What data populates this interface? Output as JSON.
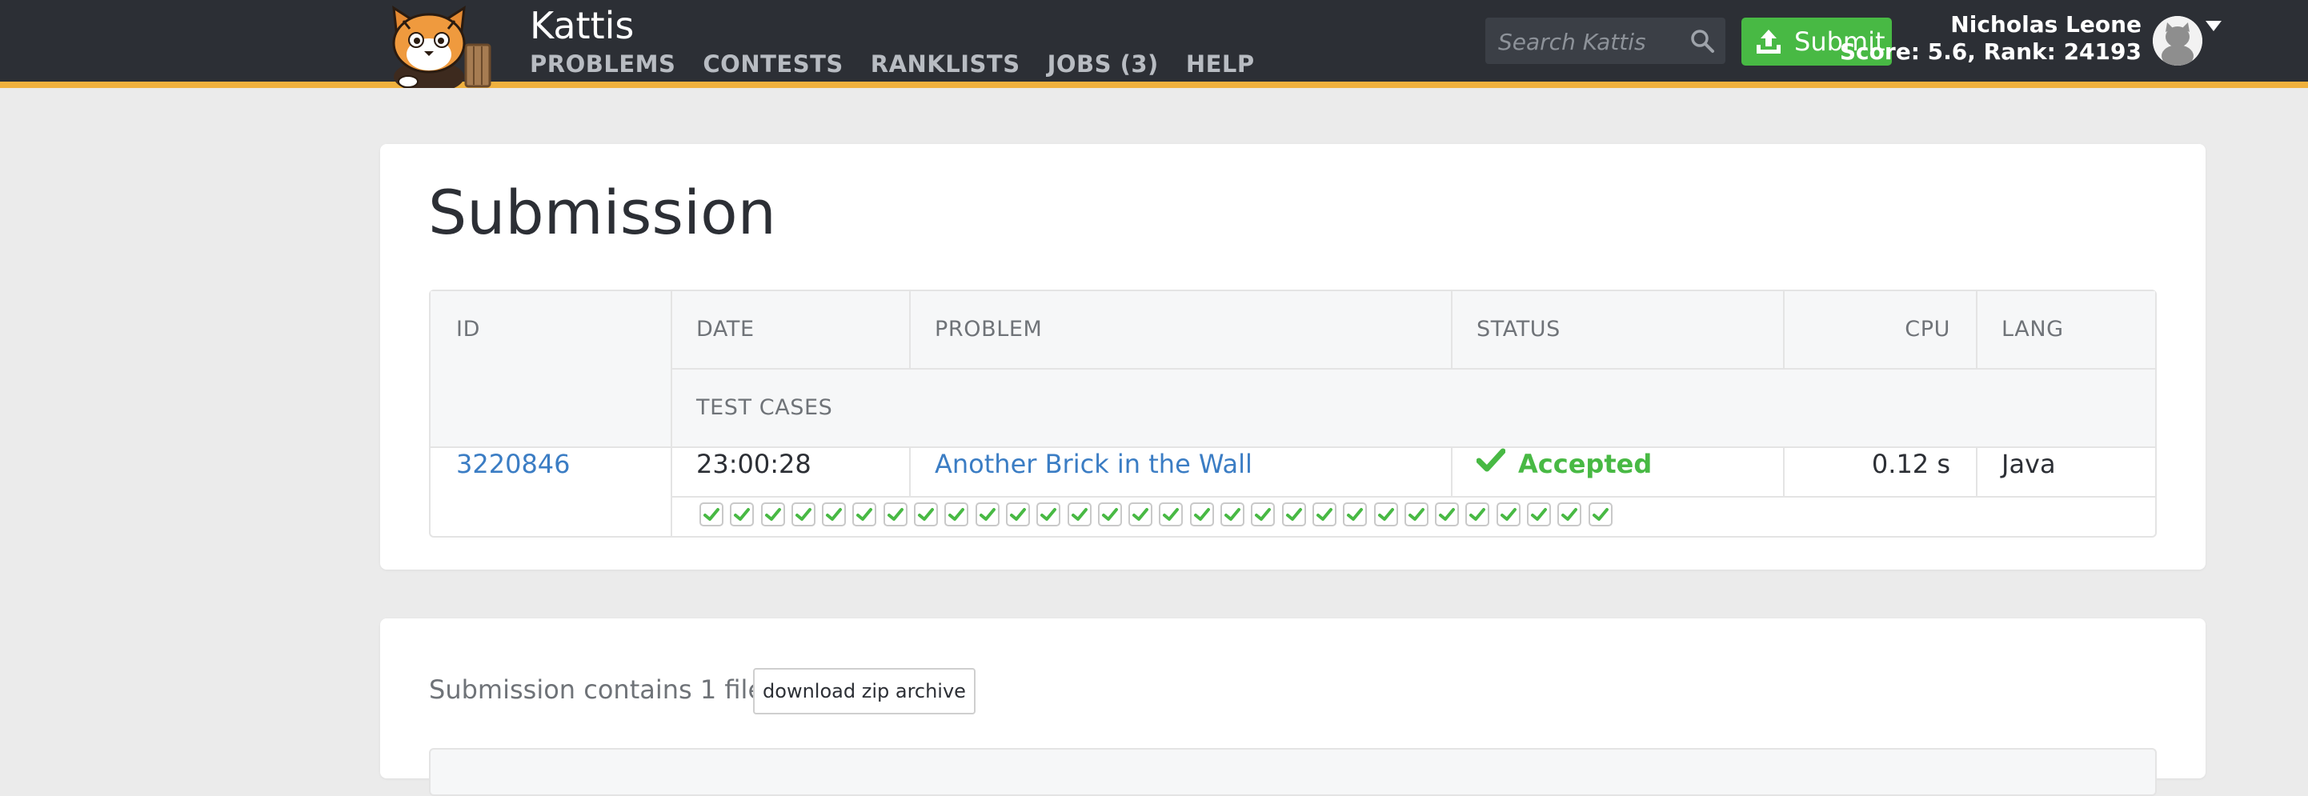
{
  "header": {
    "brand": "Kattis",
    "nav": [
      "PROBLEMS",
      "CONTESTS",
      "RANKLISTS",
      "JOBS (3)",
      "HELP"
    ],
    "search_placeholder": "Search Kattis",
    "submit_label": "Submit",
    "user_name": "Nicholas Leone",
    "user_stats": "Score: 5.6, Rank: 24193"
  },
  "submission": {
    "title": "Submission",
    "columns": {
      "id": "ID",
      "date": "DATE",
      "problem": "PROBLEM",
      "status": "STATUS",
      "cpu": "CPU",
      "lang": "LANG",
      "test_cases": "TEST CASES"
    },
    "row": {
      "id": "3220846",
      "date": "23:00:28",
      "problem": "Another Brick in the Wall",
      "status": "Accepted",
      "cpu": "0.12 s",
      "lang": "Java"
    },
    "test_cases_passed": 30,
    "test_case_result": "accepted"
  },
  "files": {
    "text": "Submission contains 1 file:",
    "download_label": "download zip archive"
  },
  "colors": {
    "topbar": "#2c2f35",
    "accent_border": "#f0b13e",
    "success": "#48b944",
    "link": "#3b7dc4"
  }
}
